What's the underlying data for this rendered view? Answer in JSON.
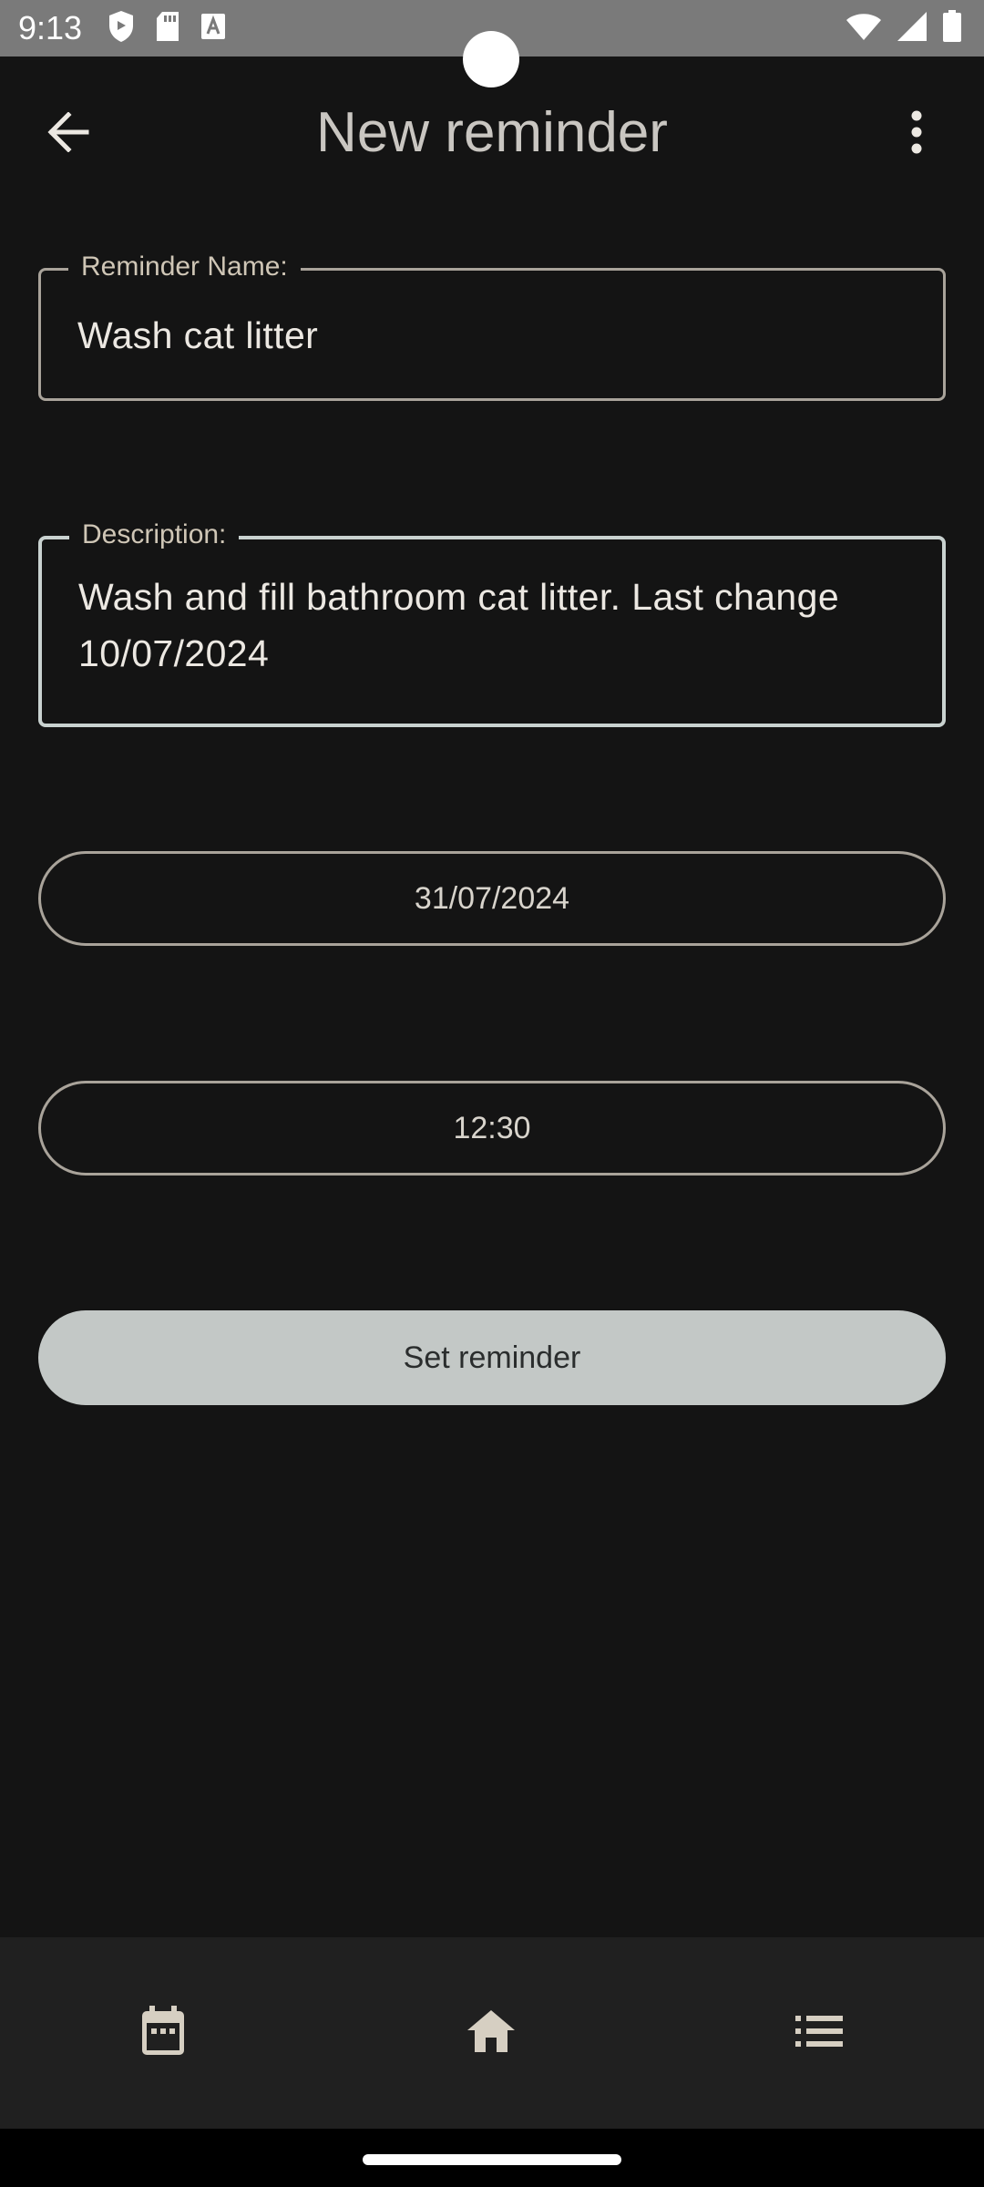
{
  "status_bar": {
    "time": "9:13",
    "left_icons": [
      "shield-icon",
      "sd-card-icon",
      "font-a-icon"
    ],
    "right_icons": [
      "wifi-icon",
      "signal-icon",
      "battery-icon"
    ]
  },
  "app_bar": {
    "title": "New reminder",
    "back_icon": "arrow-back-icon",
    "overflow_icon": "more-vert-icon"
  },
  "form": {
    "name": {
      "label": "Reminder Name:",
      "value": "Wash cat litter"
    },
    "description": {
      "label": "Description:",
      "value": "Wash and fill bathroom cat litter. Last change 10/07/2024"
    },
    "date_button": "31/07/2024",
    "time_button": "12:30",
    "submit_button": "Set reminder"
  },
  "bottom_nav": {
    "items": [
      {
        "icon": "calendar-icon"
      },
      {
        "icon": "home-icon"
      },
      {
        "icon": "list-icon"
      }
    ]
  },
  "colors": {
    "background": "#141414",
    "nav_background": "#202020",
    "outline": "#a9a39a",
    "focused_outline": "#c9d2d0",
    "filled_button": "#c3c8c6",
    "nav_icon": "#d6cfc2"
  }
}
